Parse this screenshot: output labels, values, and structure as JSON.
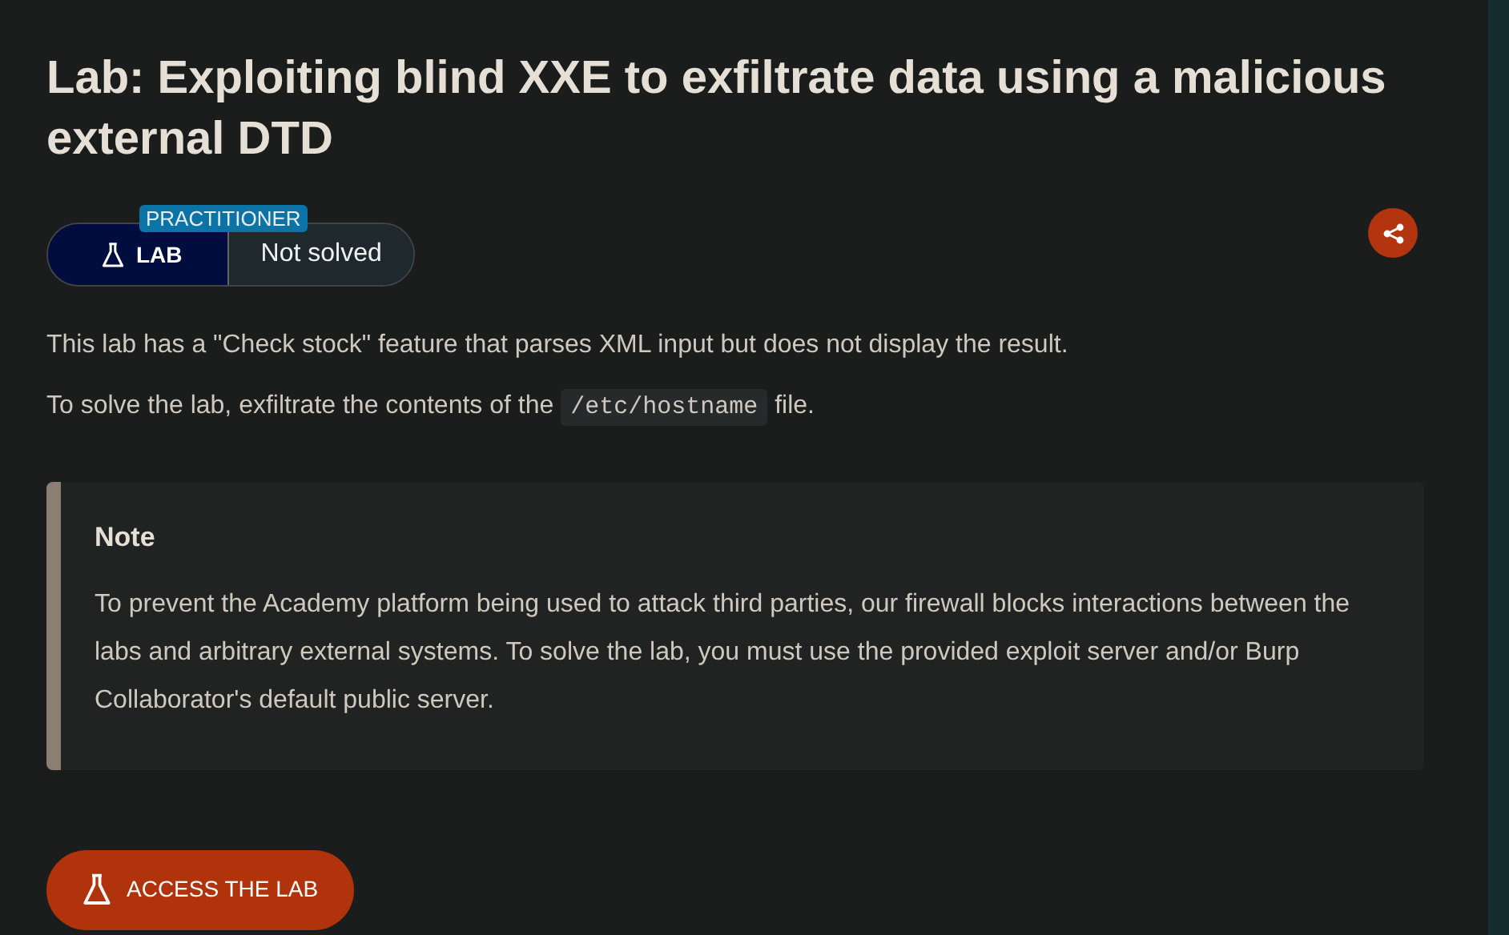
{
  "title": "Lab: Exploiting blind XXE to exfiltrate data using a malicious external DTD",
  "badge": {
    "level": "PRACTITIONER",
    "type": "LAB",
    "status": "Not solved"
  },
  "paragraphs": [
    {
      "before": "This lab has a \"Check stock\" feature that parses XML input but does not display the result."
    },
    {
      "before": "To solve the lab, exfiltrate the contents of the",
      "code": "/etc/hostname",
      "after": "file."
    }
  ],
  "note": {
    "heading": "Note",
    "text": "To prevent the Academy platform being used to attack third parties, our firewall blocks interactions between the labs and arbitrary external systems. To solve the lab, you must use the provided exploit server and/or Burp Collaborator's default public server."
  },
  "button": "ACCESS THE LAB"
}
